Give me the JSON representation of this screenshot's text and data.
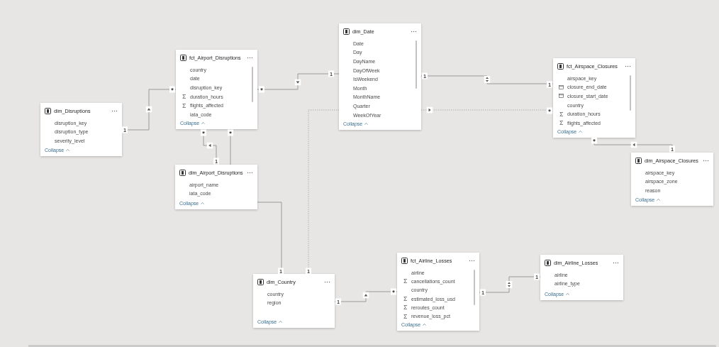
{
  "cards": [
    {
      "title": "dim_Disruptions",
      "scrollbar": false,
      "collapse": "Collapse",
      "fields": [
        {
          "name": "disruption_key",
          "kind": "column"
        },
        {
          "name": "disruption_type",
          "kind": "column"
        },
        {
          "name": "severity_level",
          "kind": "column"
        }
      ]
    },
    {
      "title": "fct_Airport_Disruptions",
      "scrollbar": true,
      "collapse": "Collapse",
      "fields": [
        {
          "name": "country",
          "kind": "column"
        },
        {
          "name": "date",
          "kind": "column"
        },
        {
          "name": "disruption_key",
          "kind": "column"
        },
        {
          "name": "duration_hours",
          "kind": "sum"
        },
        {
          "name": "flights_affected",
          "kind": "sum"
        },
        {
          "name": "iata_code",
          "kind": "column"
        }
      ]
    },
    {
      "title": "dim_Airport_Disruptions",
      "scrollbar": false,
      "collapse": "Collapse",
      "fields": [
        {
          "name": "airport_name",
          "kind": "column"
        },
        {
          "name": "iata_code",
          "kind": "column"
        }
      ]
    },
    {
      "title": "dim_Date",
      "scrollbar": true,
      "collapse": "Collapse",
      "fields": [
        {
          "name": "Date",
          "kind": "column"
        },
        {
          "name": "Day",
          "kind": "column"
        },
        {
          "name": "DayName",
          "kind": "column"
        },
        {
          "name": "DayOfWeek",
          "kind": "column"
        },
        {
          "name": "IsWeekend",
          "kind": "column"
        },
        {
          "name": "Month",
          "kind": "column"
        },
        {
          "name": "MonthName",
          "kind": "column"
        },
        {
          "name": "Quarter",
          "kind": "column"
        },
        {
          "name": "WeekOfYear",
          "kind": "column"
        }
      ]
    },
    {
      "title": "fct_Airspace_Closures",
      "scrollbar": true,
      "collapse": "Collapse",
      "fields": [
        {
          "name": "airspace_key",
          "kind": "column"
        },
        {
          "name": "closure_end_date",
          "kind": "date"
        },
        {
          "name": "closure_start_date",
          "kind": "date"
        },
        {
          "name": "country",
          "kind": "column"
        },
        {
          "name": "duration_hours",
          "kind": "sum"
        },
        {
          "name": "flights_affected",
          "kind": "sum"
        }
      ]
    },
    {
      "title": "dim_Airspace_Closures",
      "scrollbar": false,
      "collapse": "Collapse",
      "fields": [
        {
          "name": "airspace_key",
          "kind": "column"
        },
        {
          "name": "airspace_zone",
          "kind": "column"
        },
        {
          "name": "reason",
          "kind": "column"
        }
      ]
    },
    {
      "title": "dim_Country",
      "scrollbar": false,
      "collapse": "Collapse",
      "fields": [
        {
          "name": "country",
          "kind": "column"
        },
        {
          "name": "region",
          "kind": "column"
        }
      ]
    },
    {
      "title": "fct_Airline_Losses",
      "scrollbar": true,
      "collapse": "Collapse",
      "fields": [
        {
          "name": "airline",
          "kind": "column"
        },
        {
          "name": "cancellations_count",
          "kind": "sum"
        },
        {
          "name": "country",
          "kind": "column"
        },
        {
          "name": "estimated_loss_usd",
          "kind": "sum"
        },
        {
          "name": "reroutes_count",
          "kind": "sum"
        },
        {
          "name": "revenue_loss_pct",
          "kind": "sum"
        }
      ]
    },
    {
      "title": "dim_Airline_Losses",
      "scrollbar": false,
      "collapse": "Collapse",
      "fields": [
        {
          "name": "airline",
          "kind": "column"
        },
        {
          "name": "airline_type",
          "kind": "column"
        }
      ]
    }
  ],
  "relationships": [
    {
      "end_a": "1",
      "end_b": "*",
      "kind": "single",
      "active": true
    },
    {
      "end_a": "1",
      "end_b": "*",
      "kind": "single",
      "active": true
    },
    {
      "end_a": "1",
      "end_b": "*",
      "kind": "single",
      "active": true
    },
    {
      "end_a": "1",
      "end_b": "*",
      "active": true
    },
    {
      "end_a": "1",
      "end_b": "1",
      "kind": "both",
      "active": true
    },
    {
      "end_a": "1",
      "end_b": "*",
      "kind": "single",
      "active": false
    },
    {
      "end_a": "*",
      "end_b": "1",
      "kind": "single",
      "active": true
    },
    {
      "end_a": "1",
      "end_b": "*",
      "kind": "single",
      "active": true
    },
    {
      "end_a": "1",
      "end_b": "1",
      "kind": "both",
      "active": true
    }
  ]
}
